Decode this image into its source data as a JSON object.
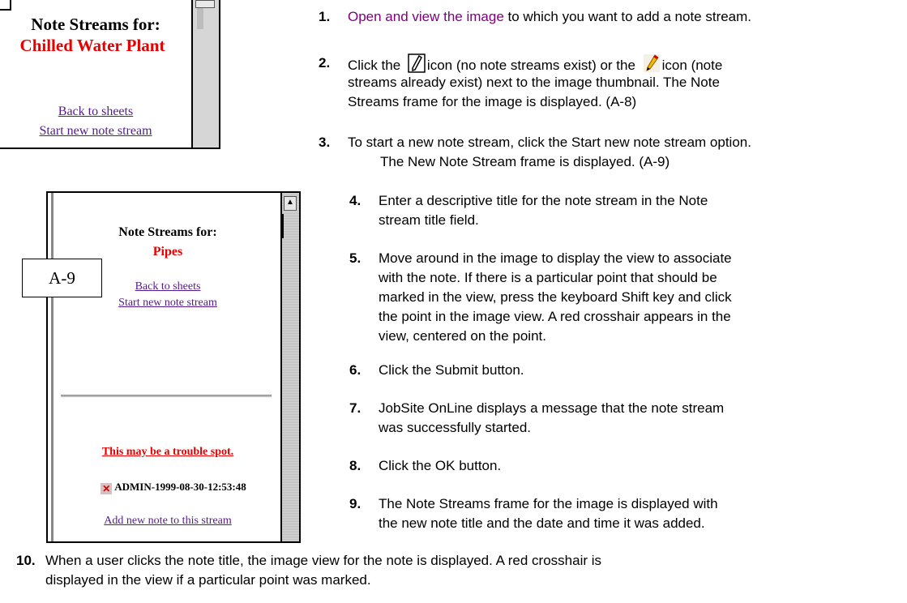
{
  "frame1": {
    "title": "Note Streams for:",
    "subtitle": "Chilled Water Plant",
    "link_back": "Back to sheets",
    "link_start": "Start new note stream"
  },
  "frame2": {
    "title": "Note Streams for:",
    "subtitle": "Pipes",
    "link_back": "Back to sheets",
    "link_start": "Start new note stream",
    "note_title": "This may be a trouble spot.",
    "note_stamp": "ADMIN-1999-08-30-12:53:48",
    "link_add": "Add new note to this stream",
    "label": "A-9"
  },
  "steps": [
    {
      "num": "1.",
      "link": "Open and view the image",
      "text": " to which you want to add a note stream."
    },
    {
      "num": "2.",
      "line1a": "Click the ",
      "line1b": "icon (no note streams exist) or the ",
      "line1c": "icon (note",
      "line2": "streams already exist) next to the image thumbnail. The Note",
      "line3": "Streams frame for the image is displayed. (A-8)"
    },
    {
      "num": "3.",
      "line1": "To start a new note stream, click the Start new note stream option.",
      "line2": "The New Note Stream frame is displayed. (A-9)"
    },
    {
      "num": "4.",
      "line1": "Enter a descriptive title for the note stream in the Note",
      "line2": "stream title field."
    },
    {
      "num": "5.",
      "line1": "Move around in the image to display the view to associate",
      "line2": "with the note. If there is a particular point that should be",
      "line3": "marked in the view, press the keyboard Shift key and click",
      "line4": "the point in the image view. A red crosshair appears in the",
      "line5": "view, centered on the point."
    },
    {
      "num": "6.",
      "line1": "Click the Submit button."
    },
    {
      "num": "7.",
      "line1": "JobSite OnLine displays a message that the note stream",
      "line2": "was successfully started."
    },
    {
      "num": "8.",
      "line1": "Click the OK button."
    },
    {
      "num": "9.",
      "line1": "The Note Streams frame for the image is displayed with",
      "line2": "the new note title and the date and time it was added."
    },
    {
      "num": "10.",
      "line1": "When a user clicks the note title, the image view for the note is displayed. A red crosshair is",
      "line2": "displayed in the view if a particular point was marked."
    }
  ],
  "icons": {
    "pencil": "pencil-icon",
    "pencil_color": "colored-pencil-icon",
    "x": "x-icon"
  }
}
